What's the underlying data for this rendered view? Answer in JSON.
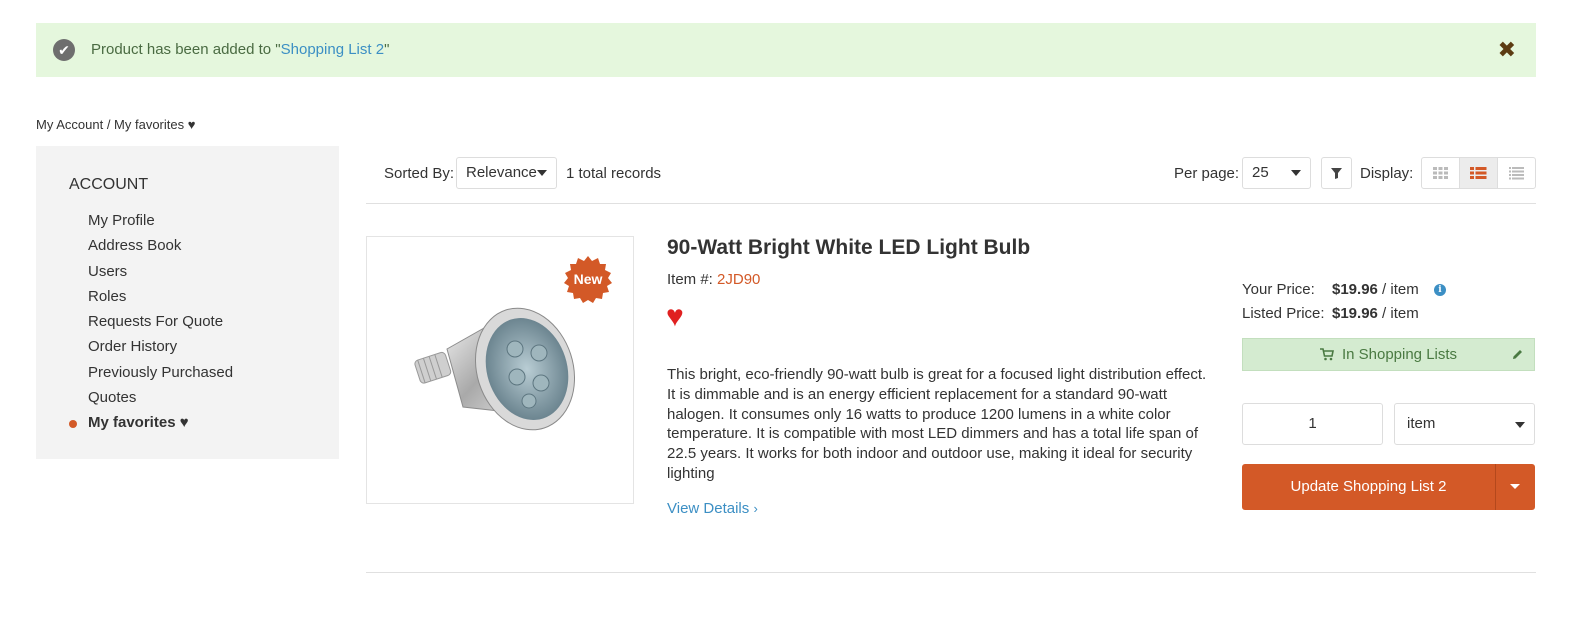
{
  "notice": {
    "prefix": "Product has been added to \"",
    "link": "Shopping List 2",
    "suffix": "\"",
    "close_glyph": "✖"
  },
  "breadcrumb": {
    "root": "My Account",
    "separator": " / ",
    "current": "My favorites ♥"
  },
  "sidebar": {
    "heading": "ACCOUNT",
    "items": [
      {
        "label": "My Profile"
      },
      {
        "label": "Address Book"
      },
      {
        "label": "Users"
      },
      {
        "label": "Roles"
      },
      {
        "label": "Requests For Quote"
      },
      {
        "label": "Order History"
      },
      {
        "label": "Previously Purchased"
      },
      {
        "label": "Quotes"
      },
      {
        "label": "My favorites ♥",
        "active": true
      }
    ]
  },
  "toolbar": {
    "sorted_by_label": "Sorted By:",
    "sort_value": "Relevance",
    "total_records": "1 total records",
    "per_page_label": "Per page:",
    "per_page_value": "25",
    "display_label": "Display:",
    "display_modes": [
      "grid",
      "list",
      "compact"
    ],
    "active_display_mode": "list",
    "accent_color": "#d35927"
  },
  "product": {
    "title": "90-Watt Bright White LED Light Bulb",
    "item_label": "Item #:",
    "item_number": "2JD90",
    "badge": "New",
    "favorite_glyph": "♥",
    "description": "This bright, eco-friendly 90-watt bulb is great for a focused light distribution effect. It is dimmable and is an energy efficient replacement for a standard 90-watt halogen. It consumes only 16 watts to produce 1200 lumens in a white color temperature. It is compatible with most LED dimmers and has a total life span of 22.5 years. It works for both indoor and outdoor use, making it ideal for security lighting",
    "view_details": "View Details",
    "your_price_label": "Your Price:",
    "your_price": "$19.96",
    "listed_price_label": "Listed Price:",
    "listed_price": "$19.96",
    "per_unit": " / item",
    "in_lists_label": "In Shopping Lists",
    "quantity": "1",
    "unit": "item",
    "update_button": "Update Shopping List 2"
  }
}
